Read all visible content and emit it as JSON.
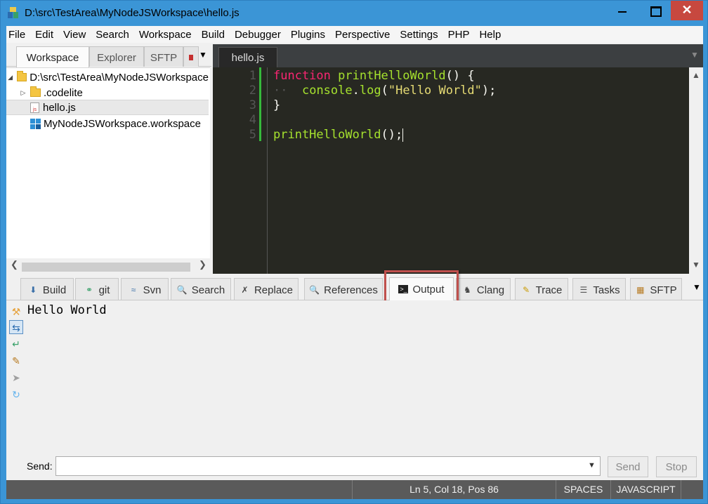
{
  "window": {
    "title": "D:\\src\\TestArea\\MyNodeJSWorkspace\\hello.js",
    "close_glyph": "✕"
  },
  "menu": [
    "File",
    "Edit",
    "View",
    "Search",
    "Workspace",
    "Build",
    "Debugger",
    "Plugins",
    "Perspective",
    "Settings",
    "PHP",
    "Help"
  ],
  "left_panel": {
    "tabs": [
      "Workspace",
      "Explorer",
      "SFTP"
    ],
    "active_tab": "Workspace",
    "tree": [
      {
        "label": "D:\\src\\TestArea\\MyNodeJSWorkspace",
        "icon": "folder-icon",
        "expanded": true
      },
      {
        "label": ".codelite",
        "icon": "folder-icon",
        "expanded": false
      },
      {
        "label": "hello.js",
        "icon": "js-file-icon",
        "selected": true
      },
      {
        "label": "MyNodeJSWorkspace.workspace",
        "icon": "workspace-icon"
      }
    ]
  },
  "editor": {
    "tab": "hello.js",
    "line_numbers": [
      "1",
      "2",
      "3",
      "4",
      "5"
    ],
    "lines": [
      "function printHelloWorld() {",
      "    console.log(\"Hello World\");",
      "}",
      "",
      "printHelloWorld();"
    ],
    "tokens": {
      "l1_kw": "function",
      "l1_fn": "printHelloWorld",
      "l1_rest": "() {",
      "l2_indent": "··",
      "l2_obj": "console",
      "l2_dot": ".",
      "l2_fn": "log",
      "l2_open": "(",
      "l2_str": "\"Hello World\"",
      "l2_close": ");",
      "l3": "}",
      "l5_fn": "printHelloWorld",
      "l5_rest": "();"
    },
    "colors": {
      "background": "#272822",
      "keyword": "#f92672",
      "function": "#a6e22e",
      "string": "#e6db74",
      "text": "#f8f8f2"
    }
  },
  "bottom_panel": {
    "tabs": [
      {
        "label": "Build",
        "icon": "build-icon"
      },
      {
        "label": "git",
        "icon": "git-icon"
      },
      {
        "label": "Svn",
        "icon": "svn-icon"
      },
      {
        "label": "Search",
        "icon": "search-icon"
      },
      {
        "label": "Replace",
        "icon": "replace-icon"
      },
      {
        "label": "References",
        "icon": "references-icon"
      },
      {
        "label": "Output",
        "icon": "terminal-icon"
      },
      {
        "label": "Clang",
        "icon": "clang-icon"
      },
      {
        "label": "Trace",
        "icon": "trace-icon"
      },
      {
        "label": "Tasks",
        "icon": "tasks-icon"
      },
      {
        "label": "SFTP",
        "icon": "sftp-icon"
      }
    ],
    "active_tab": "Output",
    "highlight_color": "#c0504d",
    "output_text": "Hello World",
    "send_label": "Send:",
    "send_value": "",
    "send_button": "Send",
    "stop_button": "Stop"
  },
  "statusbar": {
    "position": "Ln 5, Col 18, Pos 86",
    "indent": "SPACES",
    "language": "JAVASCRIPT"
  }
}
